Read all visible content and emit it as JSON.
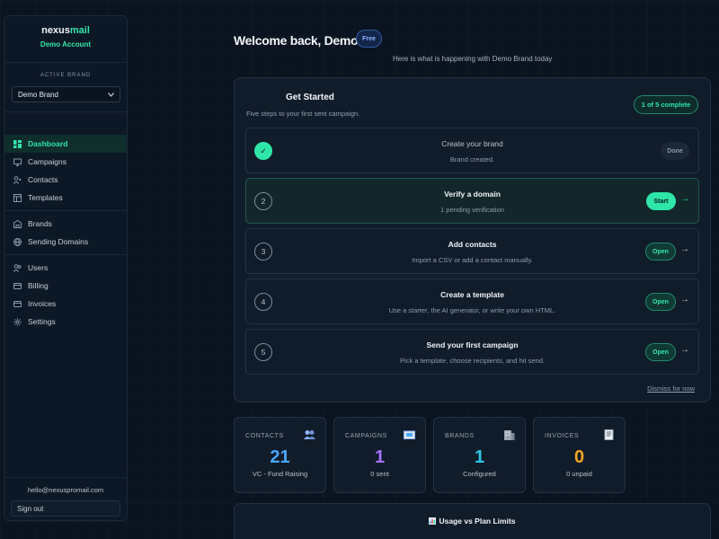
{
  "sidebar": {
    "logo_main": "nexus",
    "logo_accent": "mail",
    "account": "Demo Account",
    "active_brand_label": "ACTIVE BRAND",
    "brand_select_value": "Demo Brand",
    "nav": {
      "dashboard": "Dashboard",
      "campaigns": "Campaigns",
      "contacts": "Contacts",
      "templates": "Templates",
      "brands": "Brands",
      "sending_domains": "Sending Domains",
      "users": "Users",
      "billing": "Billing",
      "invoices": "Invoices",
      "settings": "Settings"
    },
    "email": "hello@nexuspromail.com",
    "sign_out": "Sign out"
  },
  "header": {
    "title": "Welcome back, Demo",
    "plan_badge": "Free",
    "subtitle": "Here is what is happening with Demo Brand today"
  },
  "get_started": {
    "title": "Get Started",
    "subtitle": "Five steps to your first sent campaign.",
    "progress": "1 of 5 complete",
    "dismiss": "Dismiss for now",
    "steps": [
      {
        "num": "✓",
        "title": "Create your brand",
        "desc": "Brand created.",
        "action": "Done"
      },
      {
        "num": "2",
        "title": "Verify a domain",
        "desc": "1 pending verification",
        "action": "Start"
      },
      {
        "num": "3",
        "title": "Add contacts",
        "desc": "Import a CSV or add a contact manually.",
        "action": "Open"
      },
      {
        "num": "4",
        "title": "Create a template",
        "desc": "Use a starter, the AI generator, or write your own HTML.",
        "action": "Open"
      },
      {
        "num": "5",
        "title": "Send your first campaign",
        "desc": "Pick a template, choose recipients, and hit send.",
        "action": "Open"
      }
    ]
  },
  "stats": [
    {
      "label": "CONTACTS",
      "value": "21",
      "caption": "VC - Fund Raising",
      "color": "#4aa8ff",
      "icon": "people-icon"
    },
    {
      "label": "CAMPAIGNS",
      "value": "1",
      "caption": "0 sent",
      "color": "#a374ff",
      "icon": "envelope-icon"
    },
    {
      "label": "BRANDS",
      "value": "1",
      "caption": "Configured",
      "color": "#2ec7e6",
      "icon": "building-icon"
    },
    {
      "label": "INVOICES",
      "value": "0",
      "caption": "0 unpaid",
      "color": "#f5a524",
      "icon": "receipt-icon"
    }
  ],
  "usage": {
    "title": "Usage vs Plan Limits"
  },
  "colors": {
    "accent": "#2ee6a8",
    "background": "#0a1420",
    "card": "#111c2a"
  }
}
